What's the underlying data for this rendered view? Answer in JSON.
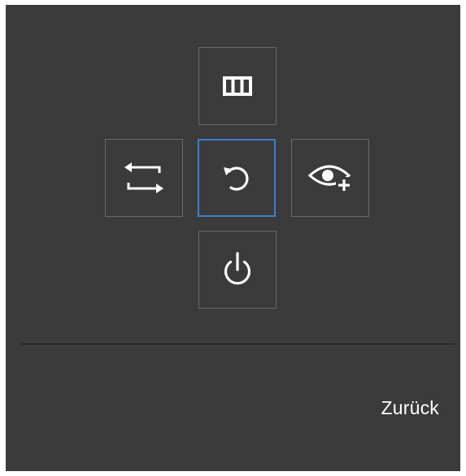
{
  "menu": {
    "items": [
      {
        "id": "top",
        "icon": "columns-icon",
        "selected": false
      },
      {
        "id": "left",
        "icon": "swap-arrows-icon",
        "selected": false
      },
      {
        "id": "center",
        "icon": "reset-rotate-icon",
        "selected": true
      },
      {
        "id": "right",
        "icon": "eye-saver-plus-icon",
        "selected": false
      },
      {
        "id": "bottom",
        "icon": "power-icon",
        "selected": false
      }
    ]
  },
  "footer": {
    "back_label": "Zurück"
  },
  "colors": {
    "panel_background": "#3b3b3b",
    "tile_border": "#6a6a6a",
    "selected_border": "#3d7fd0",
    "icon": "#ffffff",
    "divider": "#1a1a1a"
  }
}
